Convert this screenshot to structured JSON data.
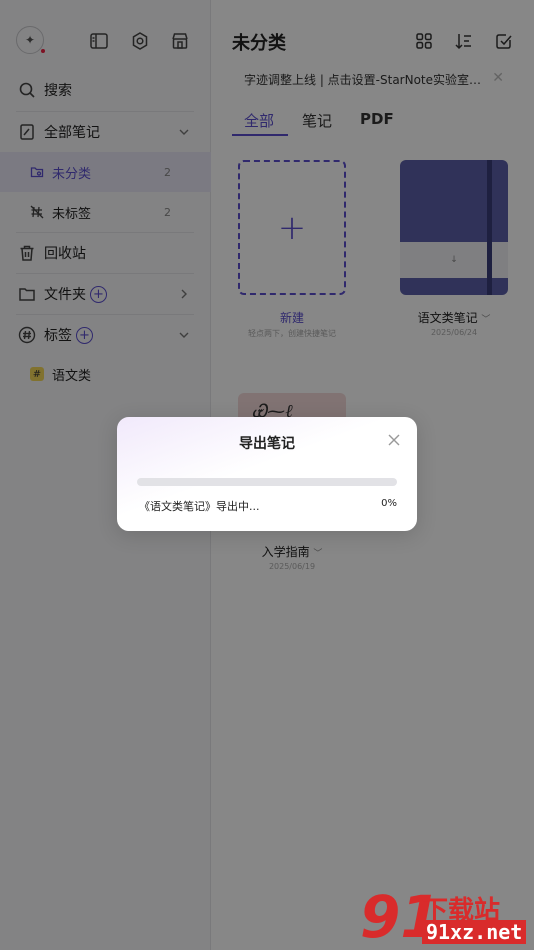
{
  "sidebar": {
    "search_label": "搜索",
    "all_notes_label": "全部笔记",
    "uncategorized": {
      "label": "未分类",
      "count": "2"
    },
    "untagged": {
      "label": "未标签",
      "count": "2"
    },
    "recycle_label": "回收站",
    "folders_label": "文件夹",
    "tags_label": "标签",
    "tag_items": [
      {
        "label": "语文类",
        "color": "#f3d75a"
      }
    ]
  },
  "header": {
    "title": "未分类",
    "announcement": "字迹调整上线 | 点击设置-StarNote实验室开..."
  },
  "tabs": [
    {
      "label": "全部",
      "active": true
    },
    {
      "label": "笔记",
      "active": false
    },
    {
      "label": "PDF",
      "active": false
    }
  ],
  "cards": {
    "new": {
      "label": "新建",
      "hint": "轻点两下，创建快捷笔记"
    },
    "notebook": {
      "label": "语文类笔记",
      "date": "2025/06/24"
    },
    "guide": {
      "label": "入学指南",
      "date": "2025/06/19"
    }
  },
  "dialog": {
    "title": "导出笔记",
    "status": "《语文类笔记》导出中...",
    "percent_text": "0%",
    "progress": 0
  },
  "watermark": {
    "top": "下载站",
    "bottom": "91xz.net"
  },
  "colors": {
    "accent": "#5b4fcf",
    "notebook_cover": "#5b5fa8",
    "tag_yellow": "#f3d75a"
  }
}
